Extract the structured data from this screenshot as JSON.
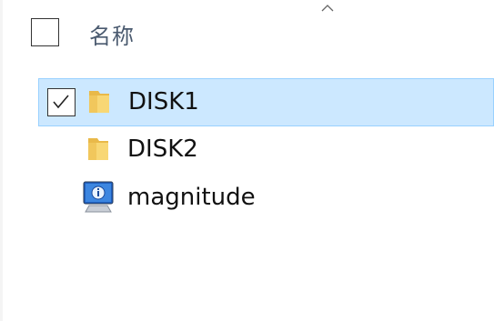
{
  "header": {
    "column_name": "名称",
    "sort_direction": "ascending"
  },
  "rows": [
    {
      "name": "DISK1",
      "icon": "folder-icon",
      "selected": true,
      "checked": true
    },
    {
      "name": "DISK2",
      "icon": "folder-icon",
      "selected": false,
      "checked": false
    },
    {
      "name": "magnitude",
      "icon": "info-monitor-icon",
      "selected": false,
      "checked": false
    }
  ],
  "colors": {
    "selection_bg": "#cce8ff",
    "selection_border": "#99d1ff",
    "folder_yellow": "#f8d775",
    "header_text": "#4a5a6f"
  }
}
